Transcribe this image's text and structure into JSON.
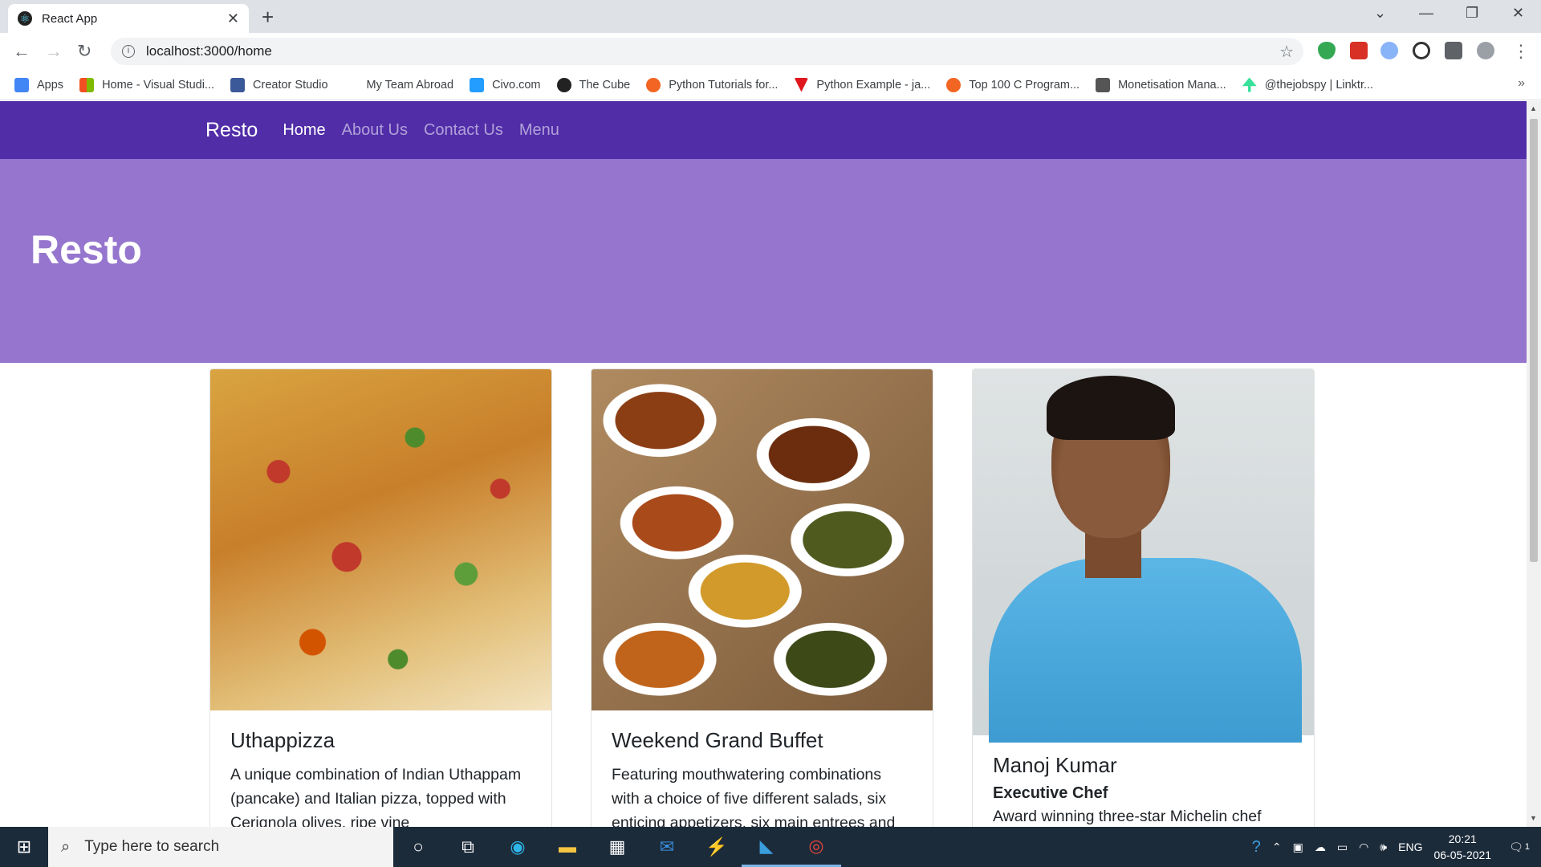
{
  "browser": {
    "tab_title": "React App",
    "new_tab_symbol": "+",
    "url": "localhost:3000/home",
    "bookmarks": [
      {
        "label": "Apps",
        "color": "#4285f4"
      },
      {
        "label": "Home - Visual Studi...",
        "color": "#f25022"
      },
      {
        "label": "Creator Studio",
        "color": "#3b5998"
      },
      {
        "label": "My Team Abroad",
        "color": "#ffffff"
      },
      {
        "label": "Civo.com",
        "color": "#239dff"
      },
      {
        "label": "The Cube",
        "color": "#222222"
      },
      {
        "label": "Python Tutorials for...",
        "color": "#f26522"
      },
      {
        "label": "Python Example - ja...",
        "color": "#e0161d"
      },
      {
        "label": "Top 100 C Program...",
        "color": "#f26522"
      },
      {
        "label": "Monetisation Mana...",
        "color": "#555555"
      },
      {
        "label": "@thejobspy | Linktr...",
        "color": "#39e09b"
      }
    ]
  },
  "navbar": {
    "brand": "Resto",
    "links": [
      "Home",
      "About Us",
      "Contact Us",
      "Menu"
    ],
    "active": "Home",
    "color": "#512da8"
  },
  "jumbotron": {
    "title": "Resto",
    "color": "#9575cd"
  },
  "cards": [
    {
      "title": "Uthappizza",
      "subtitle": "",
      "text": "A unique combination of Indian Uthappam (pancake) and Italian pizza, topped with Cerignola olives, ripe vine"
    },
    {
      "title": "Weekend Grand Buffet",
      "subtitle": "",
      "text": "Featuring mouthwatering combinations with a choice of five different salads, six enticing appetizers, six main entrees and"
    },
    {
      "title": "Manoj Kumar",
      "subtitle": "Executive Chef",
      "text": "Award winning three-star Michelin chef"
    }
  ],
  "taskbar": {
    "search_placeholder": "Type here to search",
    "language": "ENG",
    "time": "20:21",
    "date": "06-05-2021",
    "notification_count": "1"
  }
}
